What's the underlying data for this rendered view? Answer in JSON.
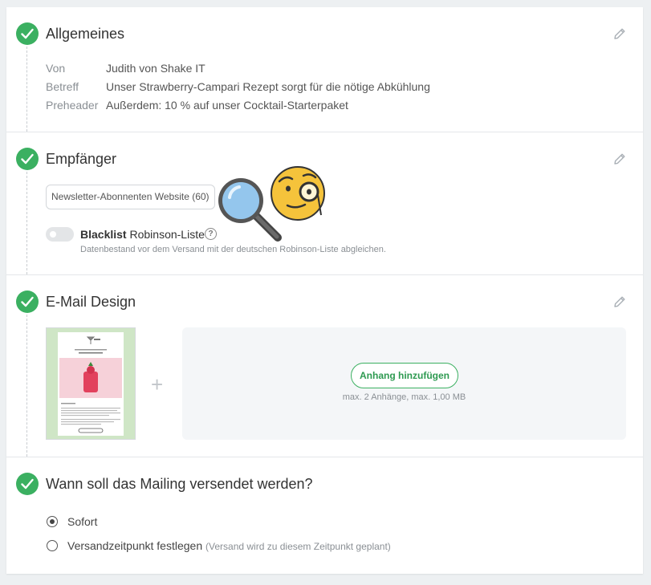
{
  "sections": {
    "allgemeines": {
      "title": "Allgemeines",
      "fields": [
        {
          "label": "Von",
          "value": "Judith von Shake IT"
        },
        {
          "label": "Betreff",
          "value": "Unser Strawberry-Campari Rezept sorgt für die nötige Abkühlung"
        },
        {
          "label": "Preheader",
          "value": "Außerdem: 10 % auf unser Cocktail-Starterpaket"
        }
      ]
    },
    "empfaenger": {
      "title": "Empfänger",
      "recipient_chip": "Newsletter-Abonnenten Website (60)",
      "blacklist_bold": "Blacklist",
      "blacklist_label": "Robinson-Liste",
      "help_glyph": "?",
      "blacklist_desc": "Datenbestand vor dem Versand mit der deutschen Robinson-Liste abgleichen.",
      "blacklist_enabled": false
    },
    "design": {
      "title": "E-Mail Design",
      "plus_glyph": "+",
      "attach_button": "Anhang hinzufügen",
      "attach_note": "max. 2 Anhänge, max. 1,00 MB"
    },
    "versand": {
      "title": "Wann soll das Mailing versendet werden?",
      "options": [
        {
          "label": "Sofort",
          "hint": "",
          "selected": true
        },
        {
          "label": "Versandzeitpunkt festlegen",
          "hint": "(Versand wird zu diesem Zeitpunkt geplant)",
          "selected": false
        }
      ]
    }
  },
  "colors": {
    "accent_green": "#3bb061",
    "background": "#edf0f2"
  },
  "icons": [
    "check-icon",
    "pencil-icon",
    "help-icon",
    "magnifier-emoji",
    "monocle-face-emoji"
  ]
}
